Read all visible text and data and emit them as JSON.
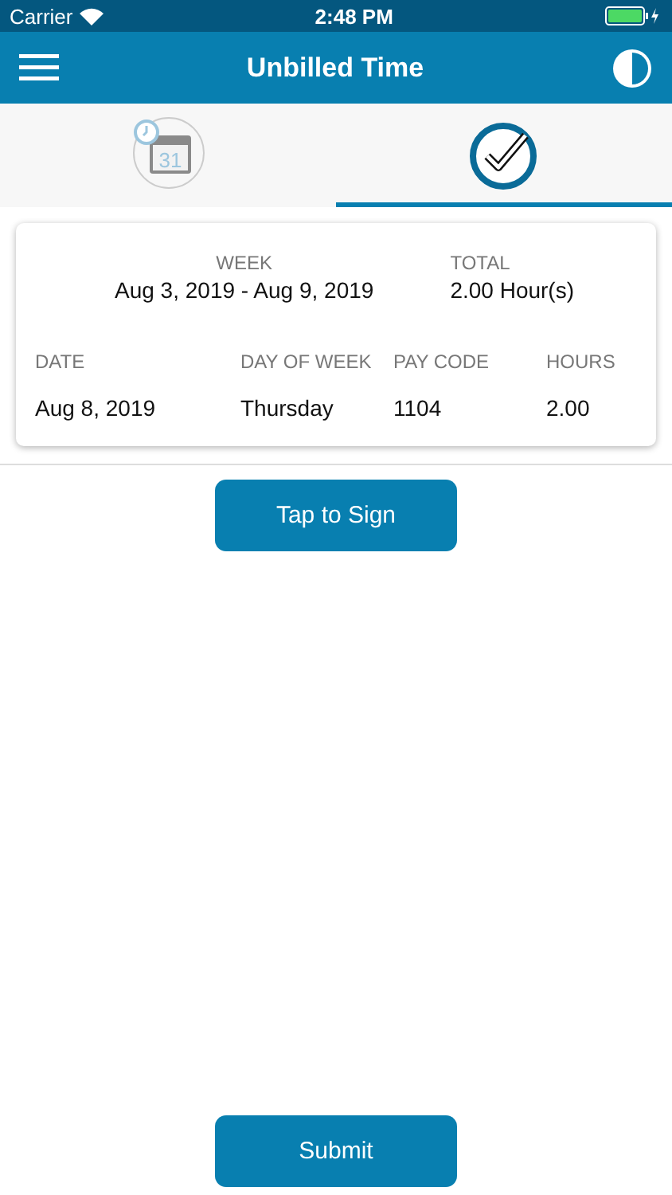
{
  "status_bar": {
    "carrier": "Carrier",
    "time": "2:48 PM"
  },
  "nav": {
    "title": "Unbilled Time"
  },
  "tabs": [
    {
      "kind": "calendar",
      "day": "31",
      "selected": false
    },
    {
      "kind": "check",
      "selected": true
    }
  ],
  "summary": {
    "week_label": "WEEK",
    "week": "Aug 3, 2019 - Aug 9, 2019",
    "total_label": "TOTAL",
    "total": "2.00 Hour(s)"
  },
  "table": {
    "columns": [
      "DATE",
      "DAY OF WEEK",
      "PAY CODE",
      "HOURS"
    ],
    "rows": [
      [
        "Aug 8, 2019",
        "Thursday",
        "1104",
        "2.00"
      ]
    ]
  },
  "sign_button": "Tap to Sign",
  "submit_button": "Submit"
}
